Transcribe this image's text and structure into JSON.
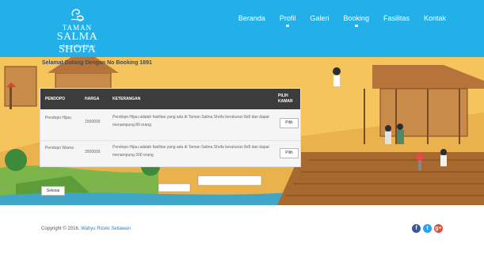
{
  "brand": {
    "line1": "TAMAN",
    "line2": "SALMA SHOFA",
    "tagline": "rekreasi & edukasi"
  },
  "nav": {
    "items": [
      {
        "label": "Beranda",
        "has_caret": false
      },
      {
        "label": "Profil",
        "has_caret": true
      },
      {
        "label": "Galeri",
        "has_caret": false
      },
      {
        "label": "Booking",
        "has_caret": true
      },
      {
        "label": "Fasilitas",
        "has_caret": false
      },
      {
        "label": "Kontak",
        "has_caret": false
      }
    ]
  },
  "welcome": "Selamat Datang Dengan No Booking 1891",
  "table": {
    "headers": [
      "PENDOPO",
      "HARGA",
      "KETERANGAN",
      "PILIH KAMAR"
    ],
    "rows": [
      {
        "name": "Pendopo Hijau",
        "price": "1500000",
        "desc": "Pendopo Hijau adalah fasilitas yang ada di Taman Salma Shofa berukuran 8x8 dan dapat menampung 80 orang",
        "button": "Pilih"
      },
      {
        "name": "Pendopo Warna",
        "price": "3500000",
        "desc": "Pendopo Hijau adalah fasilitas yang ada di Taman Salma Shofa berukuran 8x8 dan dapat menampung 300 orang",
        "button": "Pilih"
      }
    ]
  },
  "finish_button": "Selesai",
  "footer": {
    "copyright": "Copyright © 2016.",
    "author": "Wahyu Rizeki Setiawan",
    "social": [
      {
        "icon": "facebook-icon",
        "glyph": "f",
        "color": "#3b5998"
      },
      {
        "icon": "twitter-icon",
        "glyph": "t",
        "color": "#2aa3ef"
      },
      {
        "icon": "google-plus-icon",
        "glyph": "g+",
        "color": "#dd4b39"
      }
    ]
  },
  "colors": {
    "header_bg": "#23b0e8",
    "hero_bg": "#f6c45c",
    "table_header_bg": "#3c3c3c"
  }
}
